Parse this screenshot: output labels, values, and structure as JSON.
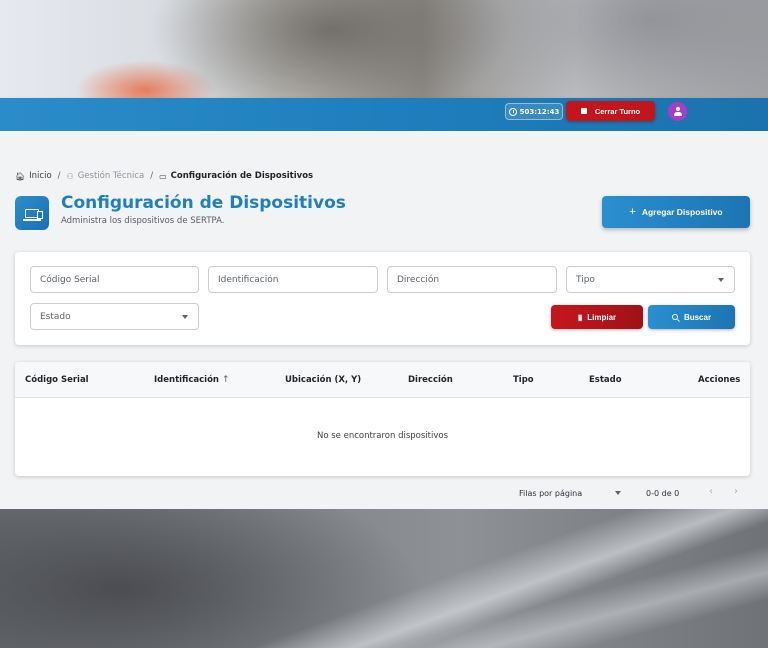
{
  "topbar": {
    "timer": "503:12:43",
    "logout_label": "Cerrar Turno"
  },
  "breadcrumb": {
    "home": "Inicio",
    "section": "Gestión Técnica",
    "current": "Configuración de Dispositivos",
    "separator": "/"
  },
  "header": {
    "title": "Configuración de Dispositivos",
    "subtitle": "Administra los dispositivos de SERTPA.",
    "add_label": "Agregar Dispositivo"
  },
  "filters": {
    "serial_placeholder": "Código Serial",
    "identificacion_placeholder": "Identificación",
    "direccion_placeholder": "Dirección",
    "tipo_label": "Tipo",
    "estado_label": "Estado",
    "clear_label": "Limpiar",
    "search_label": "Buscar"
  },
  "table": {
    "columns": [
      "Código Serial",
      "Identificación",
      "Ubicación (X, Y)",
      "Dirección",
      "Tipo",
      "Estado",
      "Acciones"
    ],
    "sort_indicator": "↑",
    "empty_message": "No se encontraron dispositivos"
  },
  "pagination": {
    "rows_per_page_label": "Filas por página",
    "range": "0-0 de 0",
    "prev": "‹",
    "next": "›"
  },
  "colors": {
    "primary": "#1f7fc0",
    "danger": "#c3161c",
    "avatar": "#a83dc6"
  }
}
